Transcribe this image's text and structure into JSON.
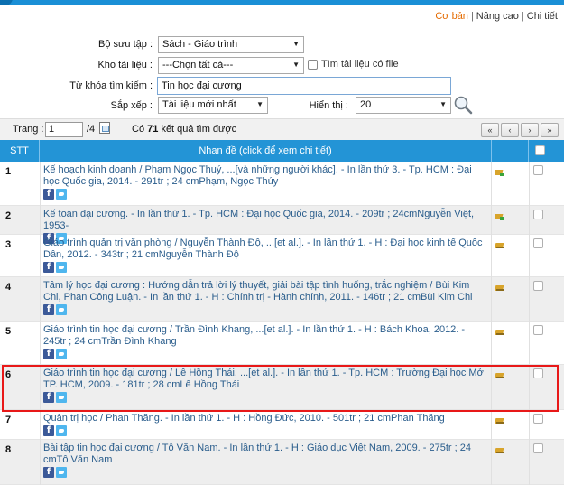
{
  "search_modes": {
    "basic": "Cơ bản",
    "sep": "|",
    "advanced": "Nâng cao",
    "detail": "Chi tiết"
  },
  "form": {
    "collection_label": "Bộ sưu tập :",
    "collection_value": "Sách - Giáo trình",
    "repository_label": "Kho tài liệu :",
    "repository_value": "---Chọn tất cả---",
    "fulltext_label": "Tìm tài liệu có file",
    "keyword_label": "Từ khóa tìm kiếm :",
    "keyword_value": "Tin học đại cương",
    "sort_label": "Sắp xếp :",
    "sort_value": "Tài liệu mới nhất",
    "display_label": "Hiển thị :",
    "display_value": "20"
  },
  "pager": {
    "page_label": "Trang :",
    "page_value": "1",
    "total_pages": "/4",
    "result_prefix": "Có",
    "result_count": "71",
    "result_suffix": "kết quả tìm được",
    "buttons": [
      "«",
      "‹",
      "›",
      "»"
    ]
  },
  "table": {
    "col_stt": "STT",
    "col_title": "Nhan đề (click để xem chi tiết)",
    "rows": [
      {
        "stt": "1",
        "text": "Kế hoạch kinh doanh / Phạm Ngọc Thuý, ...[và những người khác]. - In lần thứ 3. - Tp. HCM : Đại học Quốc gia, 2014. - 291tr ; 24 cmPhạm, Ngọc Thúy",
        "icon": "book-green-icon"
      },
      {
        "stt": "2",
        "text": "Kế toán đại cương. - In lần thứ 1. - Tp. HCM : Đại học Quốc gia, 2014. - 209tr ; 24cmNguyễn Việt, 1953-",
        "icon": "book-green-icon"
      },
      {
        "stt": "3",
        "text": "Giáo trình quản trị văn phòng / Nguyễn Thành Độ, ...[et al.]. - In lần thứ 1. - H : Đại học kinh tế Quốc Dân, 2012. - 343tr ; 21 cmNguyễn Thành Độ",
        "icon": "book-icon"
      },
      {
        "stt": "4",
        "text": "Tâm lý học đại cương : Hướng dẫn trả lời lý thuyết, giải bài tập tình huống, trắc nghiệm / Bùi Kim Chi, Phan Công Luận. - In lần thứ 1. - H : Chính trị - Hành chính, 2011. - 146tr ; 21 cmBùi Kim Chi",
        "icon": "book-icon"
      },
      {
        "stt": "5",
        "text": "Giáo trình tin học đại cương / Trần Đình Khang, ...[et al.]. - In lần thứ 1. - H : Bách Khoa, 2012. - 245tr ; 24 cmTrần Đình Khang",
        "icon": "book-icon"
      },
      {
        "stt": "6",
        "text": "Giáo trình tin học đại cương / Lê Hồng Thái, ...[et al.]. - In lần thứ 1. - Tp. HCM : Trường Đại học Mở TP. HCM, 2009. - 181tr ; 28 cmLê Hồng Thái",
        "icon": "book-icon"
      },
      {
        "stt": "7",
        "text": "Quản trị học / Phan Thăng. - In lần thứ 1. - H : Hồng Đức, 2010. - 501tr ; 21 cmPhan Thăng",
        "icon": "book-icon"
      },
      {
        "stt": "8",
        "text": "Bài tập tin học đại cương / Tô Văn Nam. - In lần thứ 1. - H : Giáo dục Việt Nam, 2009. - 275tr ; 24 cmTô Văn Nam",
        "icon": "book-icon"
      }
    ]
  },
  "colors": {
    "header_blue": "#2394d6",
    "accent_orange": "#e46b00",
    "highlight_red": "#e81818",
    "link_blue": "#2a5d8c"
  }
}
